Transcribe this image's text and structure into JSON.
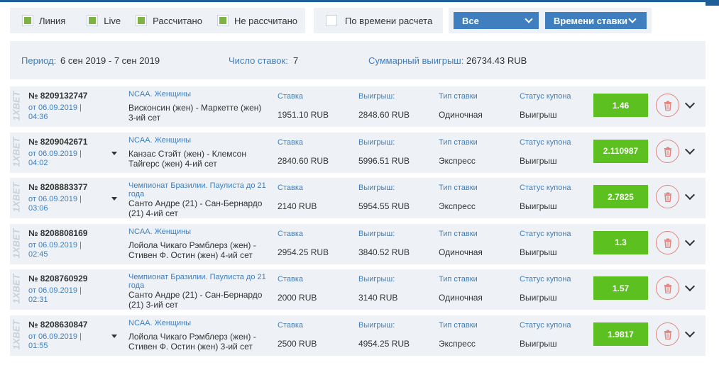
{
  "filters": {
    "items": [
      {
        "label": "Линия",
        "checked": true
      },
      {
        "label": "Live",
        "checked": true
      },
      {
        "label": "Рассчитано",
        "checked": true
      },
      {
        "label": "Не рассчитано",
        "checked": true
      }
    ],
    "by_time_label": "По времени расчета",
    "dropdown_all": "Все",
    "dropdown_sort": "Времени ставки"
  },
  "summary": {
    "period_label": "Период:",
    "period_value": "6 сен 2019 - 7 сен 2019",
    "count_label": "Число ставок:",
    "count_value": "7",
    "total_label": "Суммарный выигрыш:",
    "total_value": "26734.43 RUB"
  },
  "columns": {
    "stake": "Ставка",
    "win": "Выигрыш:",
    "type": "Тип ставки",
    "status": "Статус купона"
  },
  "brand_text": "1XBET",
  "colors": {
    "accent": "#3f7fc0",
    "odds_green": "#5cc021",
    "delete_red": "#e2837f"
  },
  "bets": [
    {
      "number": "№ 8209132747",
      "date": "от 06.09.2019 |",
      "time": "04:36",
      "league": "NCAA. Женщины",
      "match": "Висконсин (жен) - Маркетте (жен) 3-ий сет",
      "stake": "1951.10 RUB",
      "win": "2848.60 RUB",
      "type": "Одиночная",
      "status": "Выигрыш",
      "odds": "1.46",
      "has_toggle": false
    },
    {
      "number": "№ 8209042671",
      "date": "от 06.09.2019 |",
      "time": "04:02",
      "league": "NCAA. Женщины",
      "match": "Канзас Стэйт (жен) - Клемсон Тайгерс (жен) 4-ий сет",
      "stake": "2840.60 RUB",
      "win": "5996.51 RUB",
      "type": "Экспресс",
      "status": "Выигрыш",
      "odds": "2.110987",
      "has_toggle": true
    },
    {
      "number": "№ 8208883377",
      "date": "от 06.09.2019 |",
      "time": "03:06",
      "league": "Чемпионат Бразилии. Паулиста до 21 года",
      "match": "Санто Андре (21) - Сан-Бернардо (21) 4-ий сет",
      "stake": "2140 RUB",
      "win": "5954.55 RUB",
      "type": "Экспресс",
      "status": "Выигрыш",
      "odds": "2.7825",
      "has_toggle": true
    },
    {
      "number": "№ 8208808169",
      "date": "от 06.09.2019 |",
      "time": "02:45",
      "league": "NCAA. Женщины",
      "match": "Лойола Чикаго Рэмблерз (жен) - Стивен Ф. Остин (жен) 4-ий сет",
      "stake": "2954.25 RUB",
      "win": "3840.52 RUB",
      "type": "Одиночная",
      "status": "Выигрыш",
      "odds": "1.3",
      "has_toggle": false
    },
    {
      "number": "№ 8208760929",
      "date": "от 06.09.2019 |",
      "time": "02:31",
      "league": "Чемпионат Бразилии. Паулиста до 21 года",
      "match": "Санто Андре (21) - Сан-Бернардо (21) 3-ий сет",
      "stake": "2000 RUB",
      "win": "3140 RUB",
      "type": "Одиночная",
      "status": "Выигрыш",
      "odds": "1.57",
      "has_toggle": false
    },
    {
      "number": "№ 8208630847",
      "date": "от 06.09.2019 |",
      "time": "01:55",
      "league": "NCAA. Женщины",
      "match": "Лойола Чикаго Рэмблерз (жен) - Стивен Ф. Остин (жен) 3-ий сет",
      "stake": "2500 RUB",
      "win": "4954.25 RUB",
      "type": "Экспресс",
      "status": "Выигрыш",
      "odds": "1.9817",
      "has_toggle": true
    }
  ]
}
